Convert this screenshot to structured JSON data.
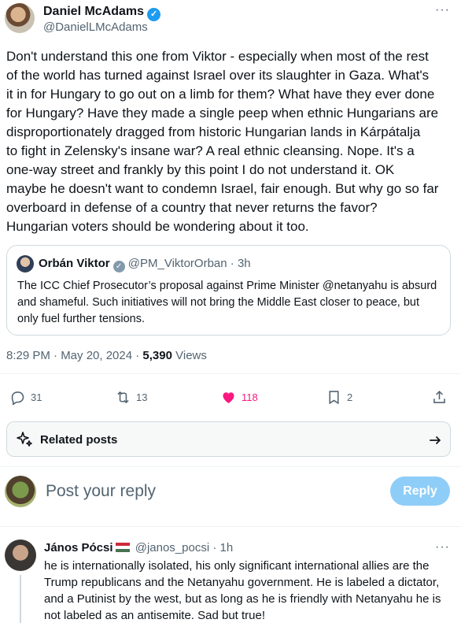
{
  "tweet": {
    "author_name": "Daniel McAdams",
    "author_handle": "@DanielLMcAdams",
    "text": "Don't understand this one from Viktor - especially when most of the rest\nof the world has turned against Israel over its slaughter in Gaza. What's\nit in for Hungary to go out on a limb for them? What have they ever done\nfor Hungary? Have they made a single peep when ethnic Hungarians are\ndisproportionately dragged from historic Hungarian lands in Kárpátalja\nto fight in Zelensky's insane war? A real ethnic cleansing. Nope. It's a\none-way street and frankly by this point I do not understand it. OK\nmaybe he doesn't want to condemn Israel, fair enough. But why go so far\noverboard in defense of a country that never returns the favor?\nHungarian voters should be wondering about it too.",
    "more_icon": "more-horizontal-icon"
  },
  "quote": {
    "author_name": "Orbán Viktor",
    "author_handle": "@PM_ViktorOrban",
    "time": "· 3h",
    "text": "The ICC Chief Prosecutor’s proposal against Prime Minister @netanyahu is absurd and shameful. Such initiatives will not bring the Middle East closer to peace, but only fuel further tensions."
  },
  "meta": {
    "time_date": "8:29 PM · May 20, 2024 · ",
    "views_count": "5,390",
    "views_label": " Views"
  },
  "actions": {
    "replies": "31",
    "reposts": "13",
    "likes": "118",
    "bookmarks": "2",
    "like_color": "#f91880"
  },
  "related": {
    "label": "Related posts"
  },
  "reply_box": {
    "placeholder": "Post your reply",
    "button_label": "Reply"
  },
  "reply": {
    "author_name": "János Pócsi",
    "author_handle": "@janos_pocsi",
    "time": "· 1h",
    "text": "he is internationally isolated, his only significant international allies are the Trump republicans and the Netanyahu government. He is labeled a dictator, and a  Putinist by the west, but as long as he is friendly with Netanyahu  he is not labeled as an antisemite. Sad but true!"
  },
  "colors": {
    "accent": "#1d9bf0",
    "reply_button": "#8ecdf8"
  }
}
